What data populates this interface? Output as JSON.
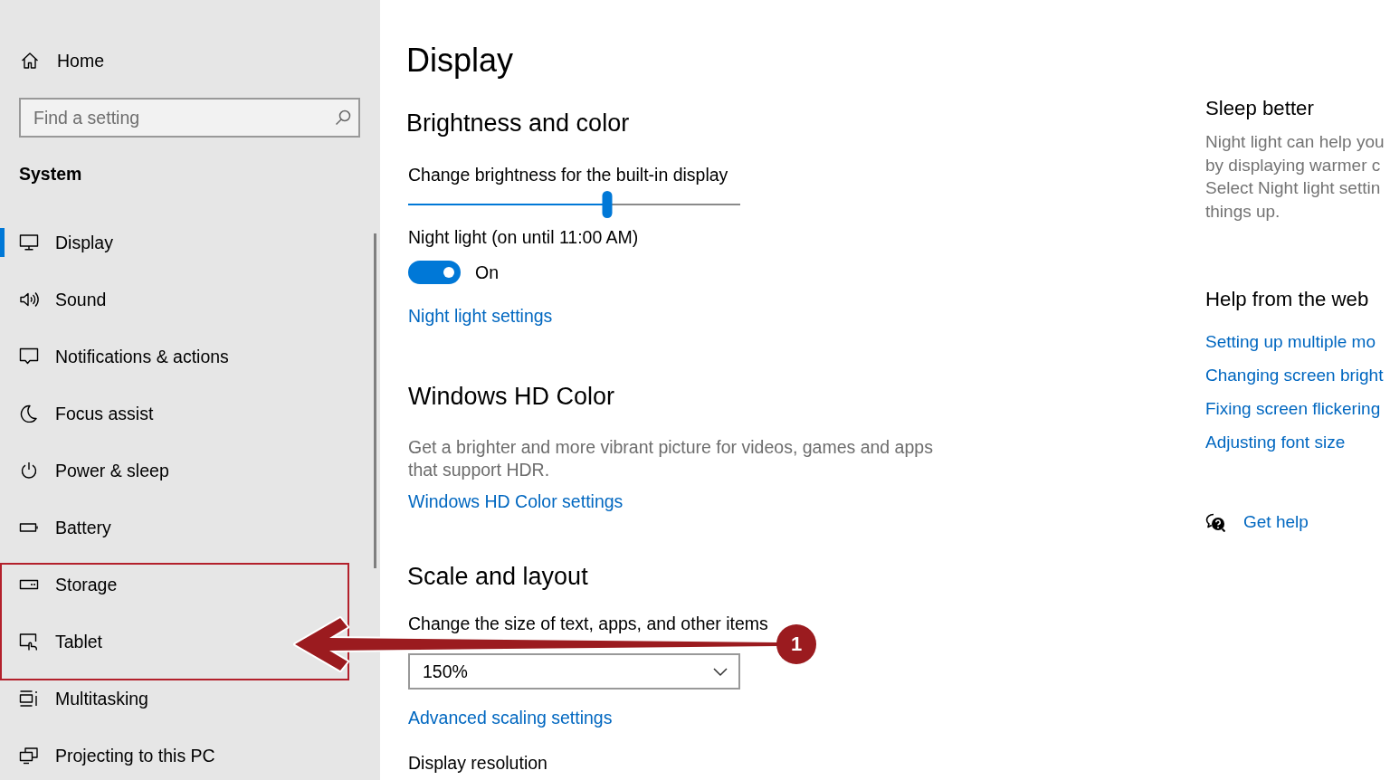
{
  "sidebar": {
    "home": "Home",
    "search": {
      "placeholder": "Find a setting"
    },
    "section_title": "System",
    "items": [
      {
        "label": "Display",
        "selected": true
      },
      {
        "label": "Sound",
        "selected": false
      },
      {
        "label": "Notifications & actions",
        "selected": false
      },
      {
        "label": "Focus assist",
        "selected": false
      },
      {
        "label": "Power & sleep",
        "selected": false
      },
      {
        "label": "Battery",
        "selected": false
      },
      {
        "label": "Storage",
        "selected": false
      },
      {
        "label": "Tablet",
        "selected": false
      },
      {
        "label": "Multitasking",
        "selected": false
      },
      {
        "label": "Projecting to this PC",
        "selected": false
      }
    ]
  },
  "main": {
    "title": "Display",
    "brightness": {
      "heading": "Brightness and color",
      "slider_label": "Change brightness for the built-in display",
      "level": 0.6,
      "night_light_label": "Night light (on until 11:00 AM)",
      "night_light": {
        "on": true,
        "state_text": "On"
      },
      "link": "Night light settings"
    },
    "hd_color": {
      "heading": "Windows HD Color",
      "description": "Get a brighter and more vibrant picture for videos, games and apps that support HDR.",
      "link": "Windows HD Color settings"
    },
    "scale": {
      "heading": "Scale and layout",
      "size_label": "Change the size of text, apps, and other items",
      "size_value": "150%",
      "link": "Advanced scaling settings",
      "resolution_label": "Display resolution"
    }
  },
  "aside": {
    "sleep_title": "Sleep better",
    "sleep_lines": [
      "Night light can help you",
      "by displaying warmer c",
      "Select Night light settin",
      "things up."
    ],
    "help_title": "Help from the web",
    "help_links": [
      "Setting up multiple mo",
      "Changing screen bright",
      "Fixing screen flickering",
      "Adjusting font size"
    ],
    "get_help": "Get help"
  },
  "annotation": {
    "badge": "1"
  }
}
